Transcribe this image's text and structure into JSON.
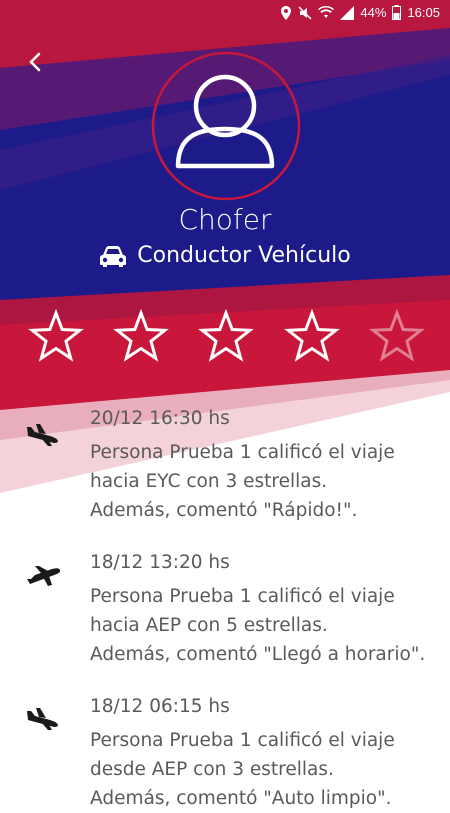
{
  "status_bar": {
    "battery": "44%",
    "time": "16:05"
  },
  "profile": {
    "name": "Chofer",
    "role": "Conductor Vehículo"
  },
  "rating": {
    "value": 4,
    "max": 5
  },
  "colors": {
    "navy": "#1d1a8a",
    "crimson": "#c8173a",
    "text": "#5a5a5a",
    "icon": "#1a1a1a"
  },
  "feed": [
    {
      "icon": "plane-landing-icon",
      "date": "20/12 16:30 hs",
      "line1": "Persona Prueba 1 calificó el viaje",
      "line2": "hacia EYC con 3 estrellas.",
      "line3": "Además, comentó \"Rápido!\"."
    },
    {
      "icon": "plane-takeoff-icon",
      "date": "18/12 13:20 hs",
      "line1": "Persona Prueba 1 calificó el viaje",
      "line2": "hacia AEP con 5 estrellas.",
      "line3": "Además, comentó \"Llegó a horario\"."
    },
    {
      "icon": "plane-landing-icon",
      "date": "18/12 06:15 hs",
      "line1": "Persona Prueba 1 calificó el viaje",
      "line2": "desde AEP con 3 estrellas.",
      "line3": "Además, comentó \"Auto limpio\"."
    }
  ]
}
